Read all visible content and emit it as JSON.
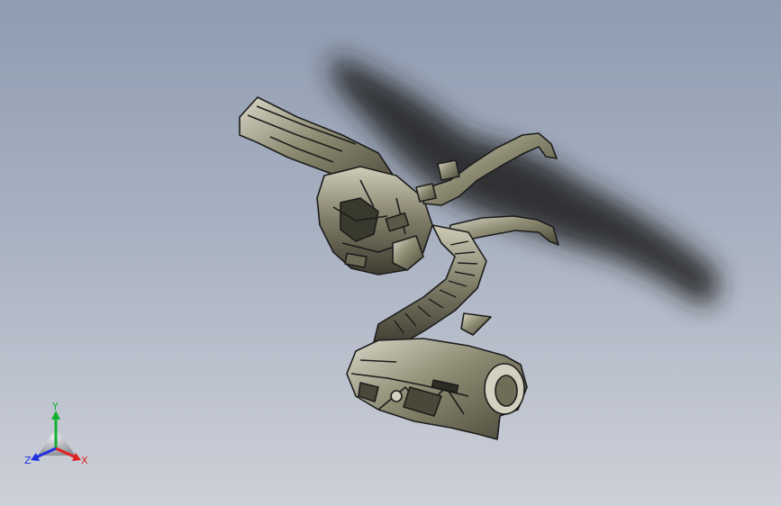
{
  "viewport": {
    "background_top": "#8f9cb1",
    "background_bottom": "#cdd0d8",
    "model": {
      "name": "mechanical-arm-weapon-model",
      "body_color": "#8e8b73",
      "edge_color": "#1c1c1c"
    }
  },
  "triad": {
    "x_label": "X",
    "y_label": "Y",
    "z_label": "Z",
    "x_color": "#e02020",
    "y_color": "#10b030",
    "z_color": "#2030e0"
  }
}
